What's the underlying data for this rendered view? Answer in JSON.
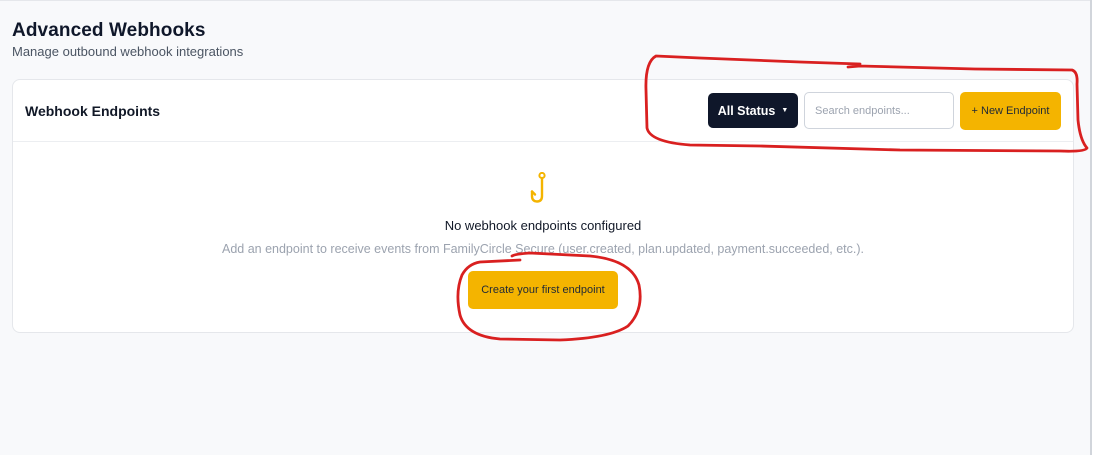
{
  "header": {
    "title": "Advanced Webhooks",
    "subtitle": "Manage outbound webhook integrations"
  },
  "card": {
    "title": "Webhook Endpoints",
    "filter": {
      "selected": "All Status"
    },
    "search": {
      "placeholder": "Search endpoints...",
      "value": ""
    },
    "new_button_label": "+ New Endpoint"
  },
  "empty_state": {
    "icon": "hook-icon",
    "title": "No webhook endpoints configured",
    "description": "Add an endpoint to receive events from FamilyCircle Secure (user.created, plan.updated, payment.succeeded, etc.).",
    "cta_label": "Create your first endpoint"
  },
  "colors": {
    "accent": "#f4b400",
    "dark_button": "#0f172a",
    "annotation": "#d92020"
  }
}
